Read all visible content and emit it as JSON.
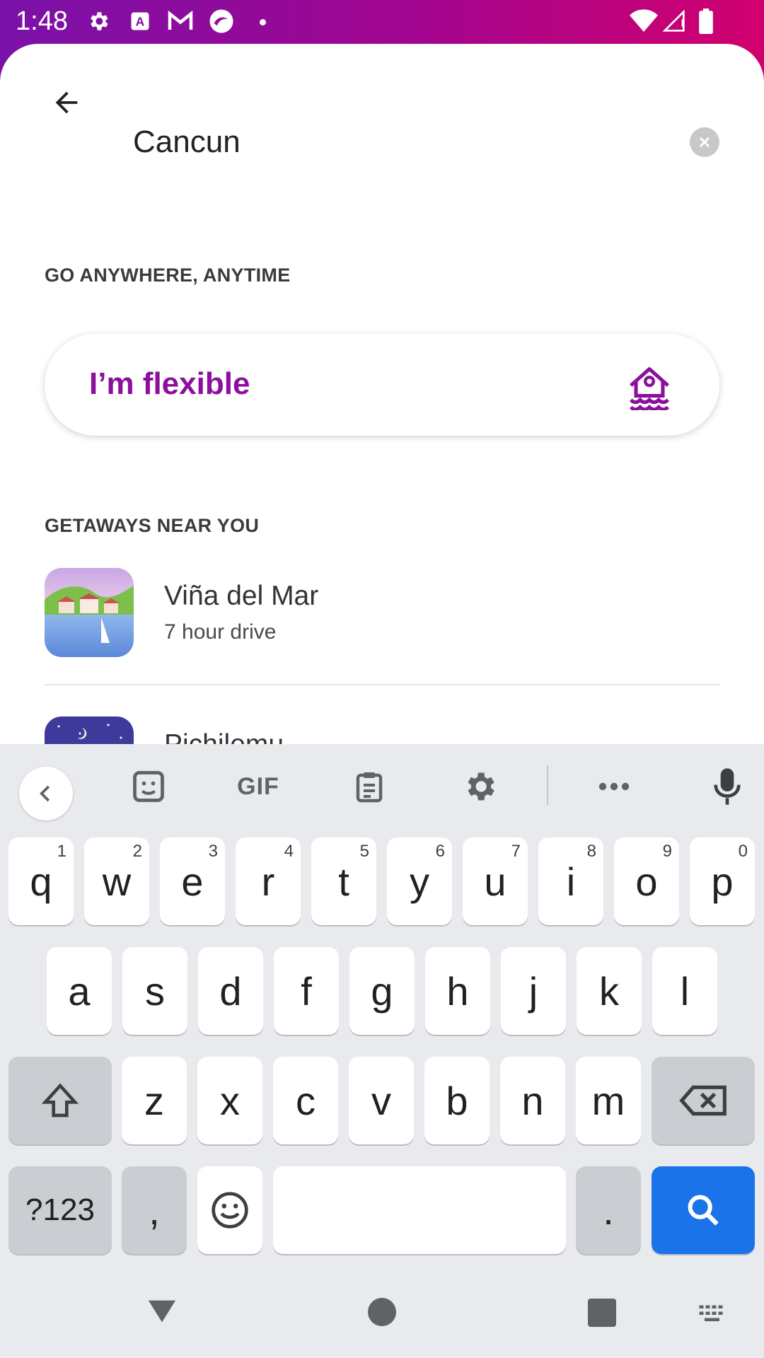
{
  "status_bar": {
    "time": "1:48",
    "left_icons": [
      "gear-icon",
      "font-a-icon",
      "gmail-icon",
      "app-icon"
    ],
    "right_icons": [
      "wifi-icon",
      "signal-icon",
      "battery-icon"
    ]
  },
  "header": {
    "search_value": "Cancun",
    "back_icon": "arrow-left-icon",
    "clear_icon": "close-circle-icon"
  },
  "flexible_section": {
    "heading": "GO ANYWHERE, ANYTIME",
    "card_label": "I’m flexible",
    "icon": "house-boat-icon",
    "accent_color": "#8c0f9e"
  },
  "getaways_section": {
    "heading": "GETAWAYS NEAR YOU",
    "items": [
      {
        "name": "Viña del Mar",
        "detail": "7 hour drive"
      },
      {
        "name": "Pichilemu",
        "detail": ""
      }
    ]
  },
  "keyboard": {
    "toolbar_icons": [
      "chevron-left-icon",
      "sticker-icon",
      "gif-icon",
      "clipboard-icon",
      "gear-icon",
      "more-icon",
      "mic-icon"
    ],
    "gif_label": "GIF",
    "row1": [
      {
        "k": "q",
        "h": "1"
      },
      {
        "k": "w",
        "h": "2"
      },
      {
        "k": "e",
        "h": "3"
      },
      {
        "k": "r",
        "h": "4"
      },
      {
        "k": "t",
        "h": "5"
      },
      {
        "k": "y",
        "h": "6"
      },
      {
        "k": "u",
        "h": "7"
      },
      {
        "k": "i",
        "h": "8"
      },
      {
        "k": "o",
        "h": "9"
      },
      {
        "k": "p",
        "h": "0"
      }
    ],
    "row2": [
      "a",
      "s",
      "d",
      "f",
      "g",
      "h",
      "j",
      "k",
      "l"
    ],
    "row3": [
      "z",
      "x",
      "c",
      "v",
      "b",
      "n",
      "m"
    ],
    "symbols_label": "?123",
    "comma_label": ",",
    "period_label": ".",
    "search_key_color": "#1a73e8"
  },
  "nav_bar": {
    "icons": [
      "back-triangle-icon",
      "home-circle-icon",
      "recents-square-icon",
      "keyboard-switch-icon"
    ]
  }
}
